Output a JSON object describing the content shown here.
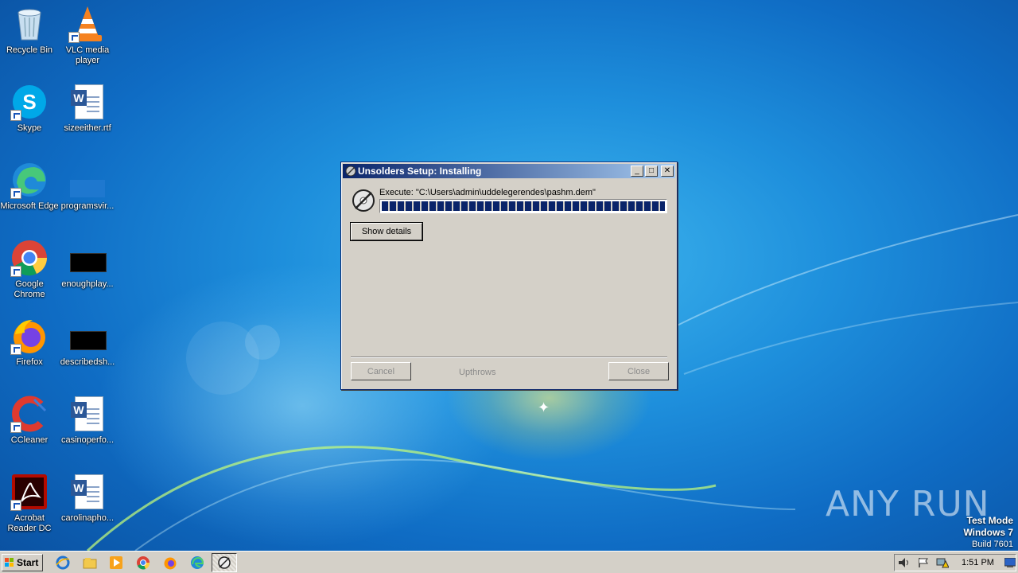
{
  "desktop": {
    "icons": [
      {
        "label": "Recycle Bin"
      },
      {
        "label": "VLC media\nplayer"
      },
      {
        "label": "Skype"
      },
      {
        "label": "sizeeither.rtf"
      },
      {
        "label": "Microsoft Edge"
      },
      {
        "label": "programsvir..."
      },
      {
        "label": "Google\nChrome"
      },
      {
        "label": "enoughplay..."
      },
      {
        "label": "Firefox"
      },
      {
        "label": "describedsh..."
      },
      {
        "label": "CCleaner"
      },
      {
        "label": "casinoperfo..."
      },
      {
        "label": "Acrobat\nReader DC"
      },
      {
        "label": "carolinapho..."
      }
    ]
  },
  "dialog": {
    "title": "Unsolders Setup: Installing",
    "minimize": "_",
    "maximize": "□",
    "close": "✕",
    "exec_text": "Execute: \"C:\\Users\\admin\\uddelegerendes\\pashm.dem\"",
    "progress": 1.0,
    "show_details": "Show details",
    "cancel": "Cancel",
    "branding": "Upthrows",
    "close_button": "Close"
  },
  "watermark": {
    "logo": "ANY RUN",
    "mode": "Test Mode",
    "os": "Windows 7",
    "build": "Build 7601"
  },
  "taskbar": {
    "start": "Start",
    "icons": [
      "internet-explorer-icon",
      "explorer-icon",
      "media-player-icon",
      "chrome-icon",
      "firefox-icon",
      "edge-icon",
      "installer-icon"
    ],
    "clock": "1:51 PM"
  },
  "colors": {
    "titlebar_start": "#0a246a",
    "titlebar_end": "#a6caf0",
    "progress": "#0a246a",
    "dialog_bg": "#d4d0c8"
  }
}
